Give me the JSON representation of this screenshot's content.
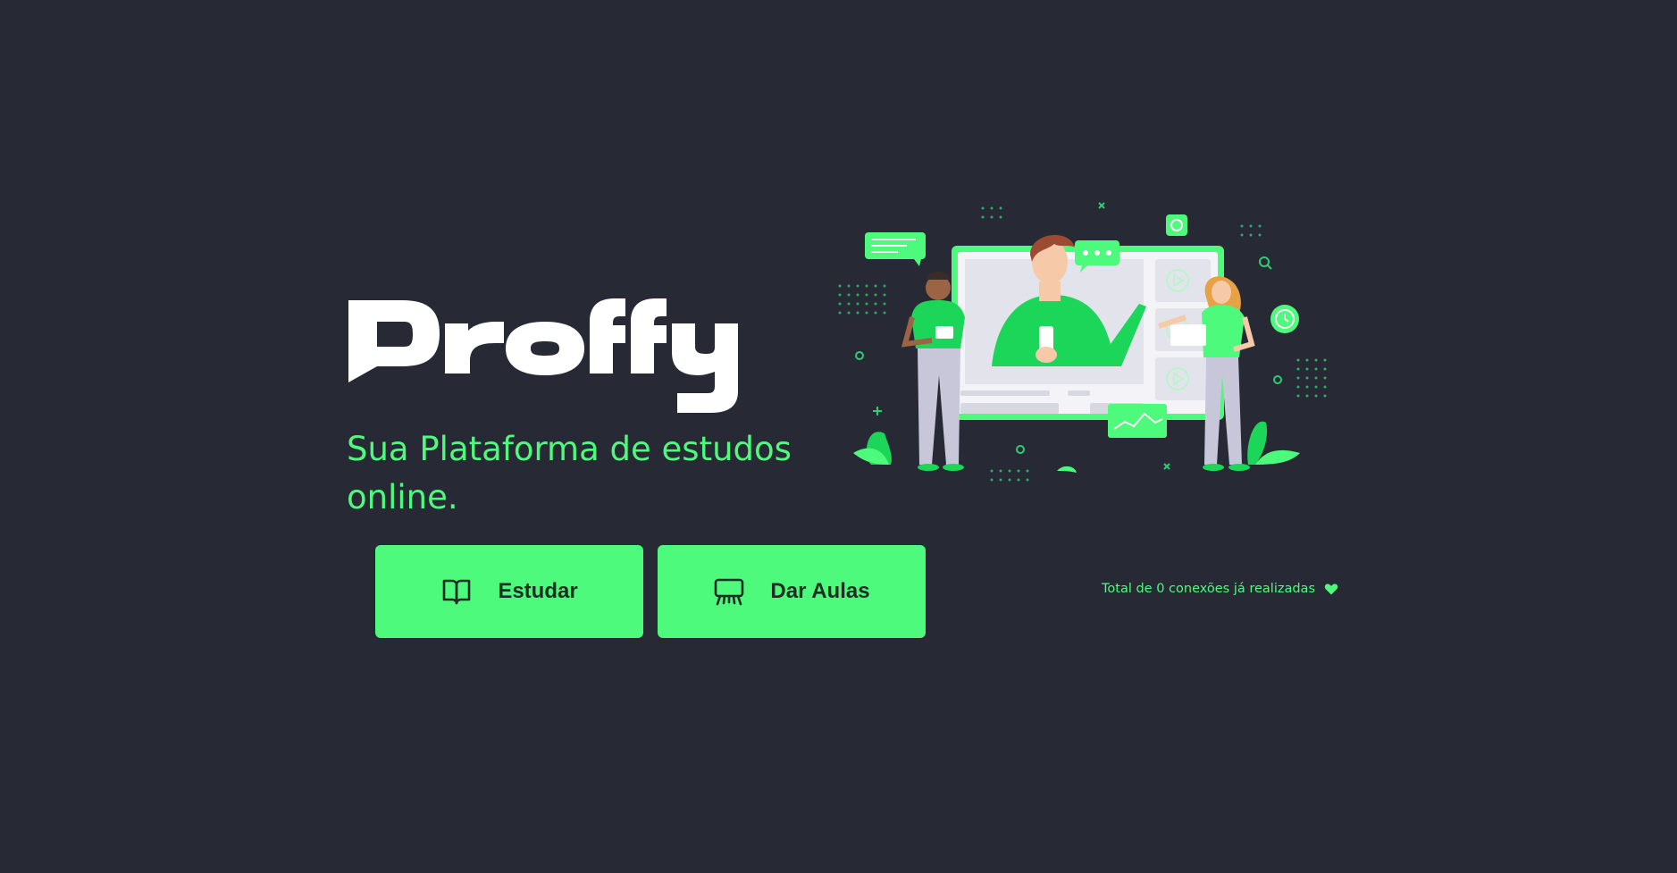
{
  "landing": {
    "logo_text": "Proffy",
    "tagline": "Sua Plataforma de estudos online.",
    "total_connections": "Total de 0 conexões já realizadas"
  },
  "buttons": {
    "study_label": "Estudar",
    "give_classes_label": "Dar Aulas"
  },
  "icons": {
    "study": "book-open-icon",
    "give_classes": "presentation-board-icon",
    "heart": "heart-icon"
  },
  "colors": {
    "background": "#272a35",
    "accent": "#4dfa7b",
    "button_text": "#1e2d26",
    "logo": "#ffffff"
  }
}
